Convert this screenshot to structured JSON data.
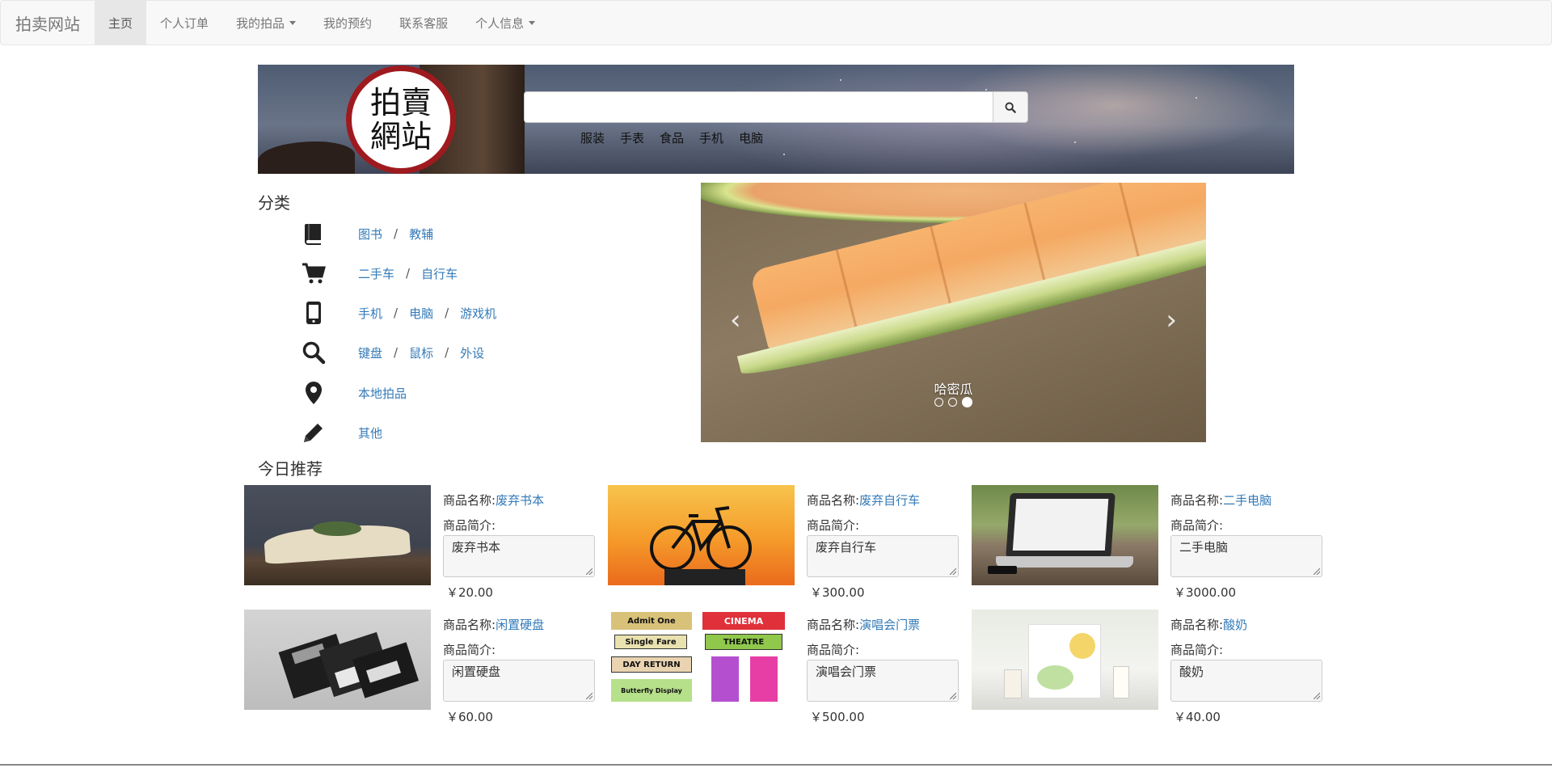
{
  "navbar": {
    "brand": "拍卖网站",
    "items": [
      {
        "label": "主页",
        "active": true
      },
      {
        "label": "个人订单"
      },
      {
        "label": "我的拍品",
        "dropdown": true
      },
      {
        "label": "我的预约"
      },
      {
        "label": "联系客服"
      },
      {
        "label": "个人信息",
        "dropdown": true
      }
    ]
  },
  "banner": {
    "logo_text": "拍賣網站",
    "search_placeholder": "",
    "quick_links": [
      "服装",
      "手表",
      "食品",
      "手机",
      "电脑"
    ]
  },
  "categories": {
    "title": "分类",
    "rows": [
      {
        "icon": "book-icon",
        "links": [
          "图书",
          "教辅"
        ]
      },
      {
        "icon": "cart-icon",
        "links": [
          "二手车",
          "自行车"
        ]
      },
      {
        "icon": "phone-icon",
        "links": [
          "手机",
          "电脑",
          "游戏机"
        ]
      },
      {
        "icon": "search-icon",
        "links": [
          "键盘",
          "鼠标",
          "外设"
        ]
      },
      {
        "icon": "map-marker-icon",
        "links": [
          "本地拍品"
        ]
      },
      {
        "icon": "pencil-icon",
        "links": [
          "其他"
        ]
      }
    ]
  },
  "carousel": {
    "caption": "哈密瓜",
    "slide_count": 3,
    "active_index": 2
  },
  "recommend": {
    "title": "今日推荐",
    "name_label": "商品名称:",
    "desc_label": "商品简介:",
    "products": [
      {
        "name": "废弃书本",
        "desc": "废弃书本",
        "price": "￥20.00",
        "image": "book-photo"
      },
      {
        "name": "废弃自行车",
        "desc": "废弃自行车",
        "price": "￥300.00",
        "image": "bicycle-photo"
      },
      {
        "name": "二手电脑",
        "desc": "二手电脑",
        "price": "￥3000.00",
        "image": "laptop-photo"
      },
      {
        "name": "闲置硬盘",
        "desc": "闲置硬盘",
        "price": "￥60.00",
        "image": "floppy-photo"
      },
      {
        "name": "演唱会门票",
        "desc": "演唱会门票",
        "price": "￥500.00",
        "image": "tickets-photo"
      },
      {
        "name": "酸奶",
        "desc": "酸奶",
        "price": "￥40.00",
        "image": "yogurt-photo"
      }
    ],
    "ticket_texts": [
      "Admit One",
      "CINEMA",
      "Single Fare",
      "THEATRE",
      "DAY RETURN",
      "Butterfly Display"
    ]
  },
  "colors": {
    "link": "#337ab7",
    "seal_red": "#9e1a1f",
    "navbar_bg": "#f8f8f8"
  }
}
